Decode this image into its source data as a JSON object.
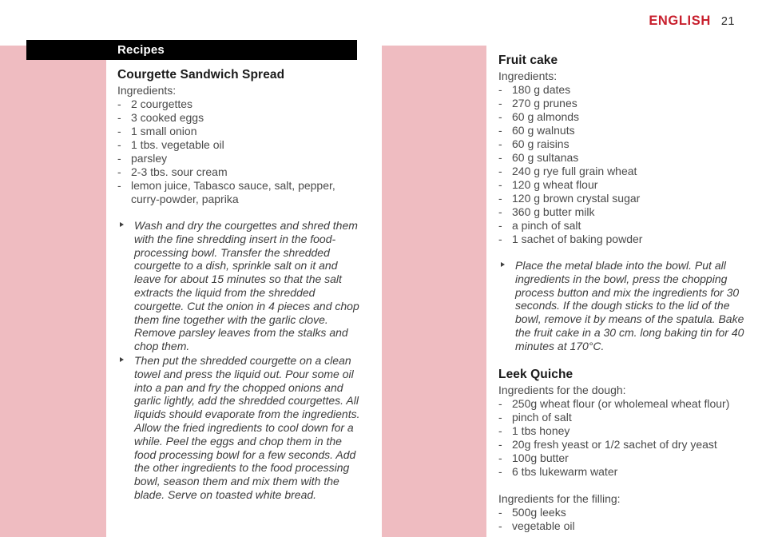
{
  "header": {
    "language": "ENGLISH",
    "page_number": "21"
  },
  "section": {
    "bar_label": "Recipes"
  },
  "colors": {
    "pink_block": "#efbcc1",
    "accent_red": "#c8202e",
    "bar_black": "#000000",
    "body_text": "#4a4a4a"
  },
  "left_column": {
    "recipe": {
      "title": "Courgette Sandwich Spread",
      "ingredients_heading": "Ingredients:",
      "ingredients": [
        "2 courgettes",
        "3 cooked eggs",
        "1 small onion",
        "1 tbs. vegetable oil",
        "parsley",
        "2-3 tbs. sour cream",
        "lemon juice, Tabasco sauce, salt, pepper, curry-powder, paprika"
      ],
      "steps": [
        "Wash and dry the courgettes and shred them with the fine shredding insert in the food-processing bowl. Transfer the shredded courgette to a dish, sprinkle salt on it and leave for about 15 minutes so that the salt extracts the liquid from the shredded courgette. Cut the onion in 4 pieces and chop them fine together with the garlic clove. Remove parsley leaves from the stalks and chop them.",
        "Then put the shredded courgette on a clean towel and press the liquid out. Pour some oil into a pan and fry the chopped onions and garlic lightly, add the shredded courgettes. All liquids should evaporate from the ingredients. Allow the fried ingredients to cool down for a while. Peel the eggs and chop them in the food processing bowl for a few seconds. Add the other ingredients to the food processing bowl, season them and mix them with the blade. Serve on toasted white bread."
      ]
    }
  },
  "right_column": {
    "recipes": [
      {
        "title": "Fruit cake",
        "ingredients_heading": "Ingredients:",
        "ingredients": [
          "180 g dates",
          "270 g prunes",
          "60 g almonds",
          "60 g walnuts",
          "60 g raisins",
          "60 g sultanas",
          "240 g rye full grain wheat",
          "120 g wheat flour",
          "120 g brown crystal sugar",
          "360 g butter milk",
          "a pinch of salt",
          "1 sachet of baking powder"
        ],
        "steps": [
          "Place the metal blade into the bowl. Put all ingredients in the bowl, press the chopping process button and mix the ingredients for 30 seconds. If the dough sticks to the lid of the bowl, remove it by means of the spatula. Bake the fruit cake in a 30 cm. long baking tin for 40 minutes at 170°C."
        ]
      },
      {
        "title": "Leek Quiche",
        "dough_heading": "Ingredients for the dough:",
        "dough_ingredients": [
          "250g wheat flour (or wholemeal wheat flour)",
          "pinch of salt",
          "1 tbs honey",
          "20g fresh yeast or 1/2 sachet of dry yeast",
          "100g butter",
          "6 tbs lukewarm water"
        ],
        "filling_heading": "Ingredients for the filling:",
        "filling_ingredients": [
          "500g leeks",
          "vegetable oil"
        ]
      }
    ]
  }
}
